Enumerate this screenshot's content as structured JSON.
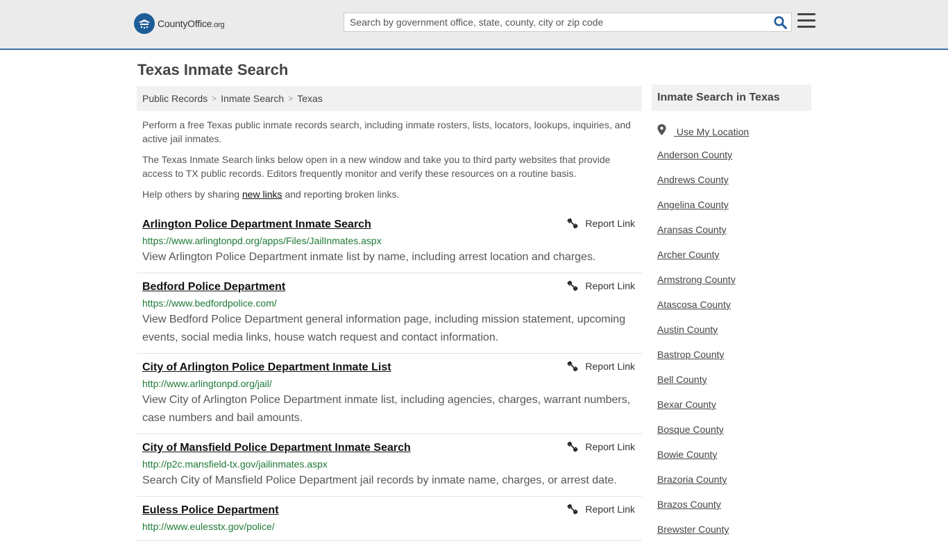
{
  "header": {
    "logo_county": "CountyOffice",
    "logo_org": ".org",
    "search_placeholder": "Search by government office, state, county, city or zip code"
  },
  "page_title": "Texas Inmate Search",
  "breadcrumb": [
    "Public Records",
    "Inmate Search",
    "Texas"
  ],
  "intro": {
    "p1": "Perform a free Texas public inmate records search, including inmate rosters, lists, locators, lookups, inquiries, and active jail inmates.",
    "p2": "The Texas Inmate Search links below open in a new window and take you to third party websites that provide access to TX public records. Editors frequently monitor and verify these resources on a routine basis.",
    "p3_before": "Help others by sharing ",
    "p3_link": "new links",
    "p3_after": " and reporting broken links."
  },
  "report_label": "Report Link",
  "listings": [
    {
      "title": "Arlington Police Department Inmate Search",
      "url": "https://www.arlingtonpd.org/apps/Files/JailInmates.aspx",
      "desc": "View Arlington Police Department inmate list by name, including arrest location and charges."
    },
    {
      "title": "Bedford Police Department",
      "url": "https://www.bedfordpolice.com/",
      "desc": "View Bedford Police Department general information page, including mission statement, upcoming events, social media links, house watch request and contact information."
    },
    {
      "title": "City of Arlington Police Department Inmate List",
      "url": "http://www.arlingtonpd.org/jail/",
      "desc": "View City of Arlington Police Department inmate list, including agencies, charges, warrant numbers, case numbers and bail amounts."
    },
    {
      "title": "City of Mansfield Police Department Inmate Search",
      "url": "http://p2c.mansfield-tx.gov/jailinmates.aspx",
      "desc": "Search City of Mansfield Police Department jail records by inmate name, charges, or arrest date."
    },
    {
      "title": "Euless Police Department",
      "url": "http://www.eulesstx.gov/police/",
      "desc": ""
    }
  ],
  "sidebar": {
    "title": "Inmate Search in Texas",
    "use_location": "Use My Location",
    "counties": [
      "Anderson County",
      "Andrews County",
      "Angelina County",
      "Aransas County",
      "Archer County",
      "Armstrong County",
      "Atascosa County",
      "Austin County",
      "Bastrop County",
      "Bell County",
      "Bexar County",
      "Bosque County",
      "Bowie County",
      "Brazoria County",
      "Brazos County",
      "Brewster County"
    ]
  }
}
